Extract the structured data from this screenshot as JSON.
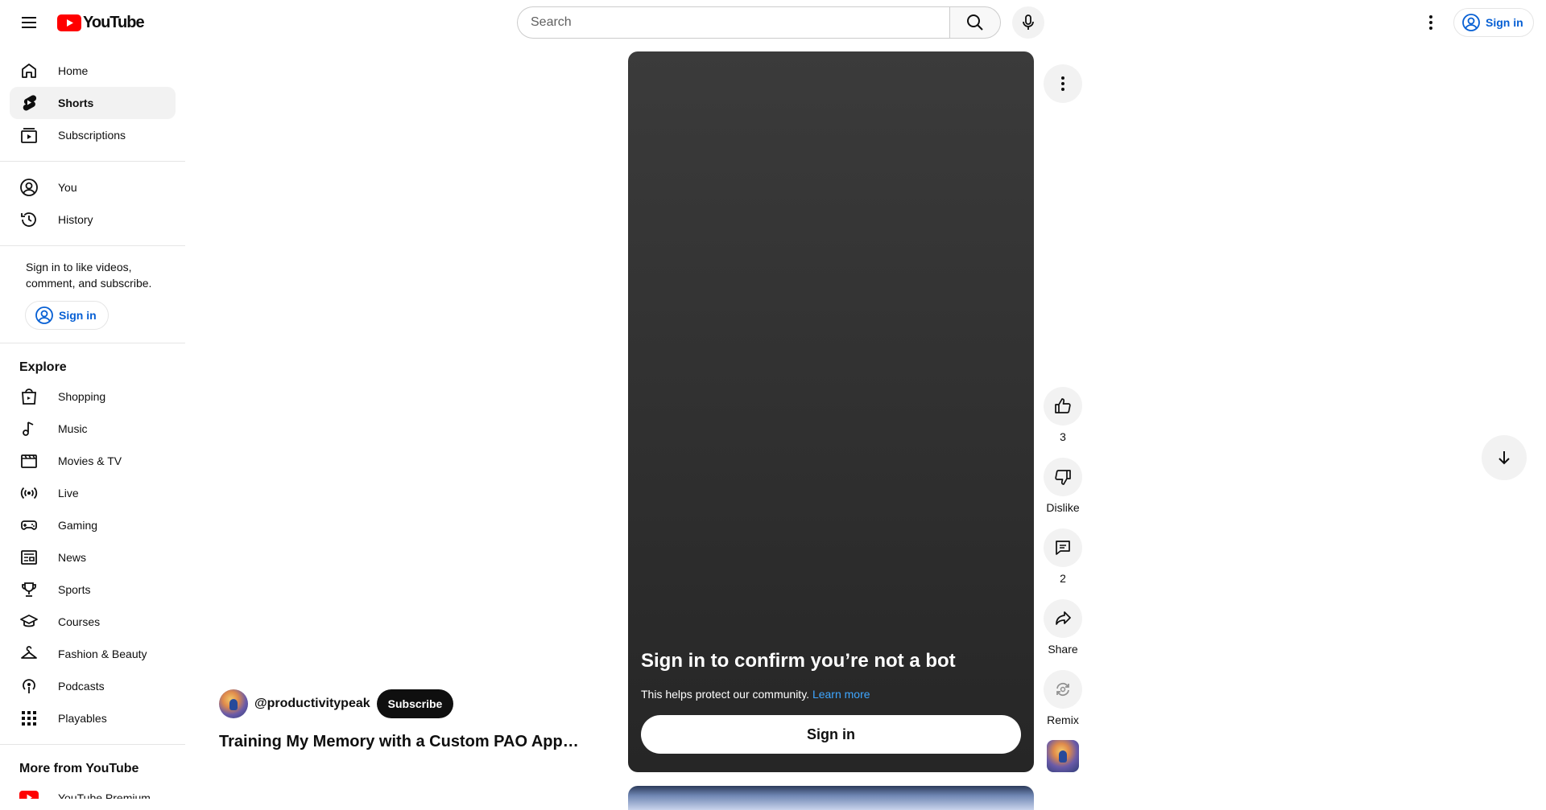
{
  "header": {
    "logo_text": "YouTube",
    "search_placeholder": "Search",
    "signin_label": "Sign in"
  },
  "sidebar": {
    "primary": [
      {
        "label": "Home",
        "icon": "home-icon",
        "active": false
      },
      {
        "label": "Shorts",
        "icon": "shorts-icon",
        "active": true
      },
      {
        "label": "Subscriptions",
        "icon": "subscriptions-icon",
        "active": false
      }
    ],
    "you": [
      {
        "label": "You",
        "icon": "you-icon"
      },
      {
        "label": "History",
        "icon": "history-icon"
      }
    ],
    "signin_prompt": "Sign in to like videos, comment, and subscribe.",
    "signin_label": "Sign in",
    "explore_heading": "Explore",
    "explore": [
      {
        "label": "Shopping",
        "icon": "shopping-icon"
      },
      {
        "label": "Music",
        "icon": "music-icon"
      },
      {
        "label": "Movies & TV",
        "icon": "movies-icon"
      },
      {
        "label": "Live",
        "icon": "live-icon"
      },
      {
        "label": "Gaming",
        "icon": "gaming-icon"
      },
      {
        "label": "News",
        "icon": "news-icon"
      },
      {
        "label": "Sports",
        "icon": "sports-icon"
      },
      {
        "label": "Courses",
        "icon": "courses-icon"
      },
      {
        "label": "Fashion & Beauty",
        "icon": "fashion-icon"
      },
      {
        "label": "Podcasts",
        "icon": "podcasts-icon"
      },
      {
        "label": "Playables",
        "icon": "playables-icon"
      }
    ],
    "more_heading": "More from YouTube",
    "more": [
      {
        "label": "YouTube Premium",
        "icon": "youtube-premium-icon"
      }
    ]
  },
  "short": {
    "channel_handle": "@productivitypeak",
    "subscribe_label": "Subscribe",
    "title": "Training My Memory with a Custom PAO App (M...",
    "overlay": {
      "heading": "Sign in to confirm you’re not a bot",
      "description": "This helps protect our community.",
      "learn_more": "Learn more",
      "signin_label": "Sign in"
    }
  },
  "actions": {
    "like_count": "3",
    "dislike_label": "Dislike",
    "comment_count": "2",
    "share_label": "Share",
    "remix_label": "Remix"
  },
  "colors": {
    "brand_red": "#ff0000",
    "link_blue": "#065fd4",
    "overlay_link": "#3ea6ff",
    "chip_bg": "#f2f2f2"
  }
}
